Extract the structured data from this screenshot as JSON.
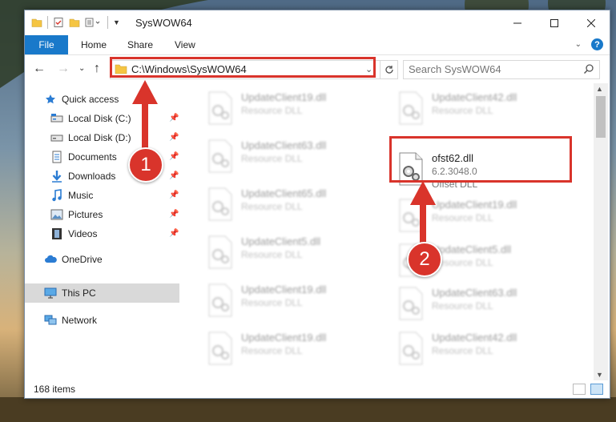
{
  "window": {
    "title": "SysWOW64"
  },
  "ribbon": {
    "tabs": [
      "File",
      "Home",
      "Share",
      "View"
    ],
    "help_label": "?"
  },
  "nav": {
    "back_label": "←",
    "forward_label": "→",
    "recent_label": "⌄",
    "up_label": "↑"
  },
  "address": {
    "path": "C:\\Windows\\SysWOW64"
  },
  "search": {
    "placeholder": "Search SysWOW64"
  },
  "sidebar": {
    "items": [
      {
        "label": "Quick access",
        "icon": "star-icon"
      },
      {
        "label": "Local Disk (C:)",
        "icon": "drive-icon"
      },
      {
        "label": "Local Disk (D:)",
        "icon": "drive-icon"
      },
      {
        "label": "Documents",
        "icon": "documents-icon"
      },
      {
        "label": "Downloads",
        "icon": "download-arrow-icon"
      },
      {
        "label": "Music",
        "icon": "music-note-icon"
      },
      {
        "label": "Pictures",
        "icon": "pictures-icon"
      },
      {
        "label": "Videos",
        "icon": "film-icon"
      },
      {
        "label": "OneDrive",
        "icon": "cloud-icon"
      },
      {
        "label": "This PC",
        "icon": "monitor-icon"
      },
      {
        "label": "Network",
        "icon": "network-icon"
      }
    ]
  },
  "files": {
    "col1": [
      {
        "name": "UpdateClient19.dll",
        "type": "Resource DLL"
      },
      {
        "name": "UpdateClient63.dll",
        "type": "Resource DLL"
      },
      {
        "name": "UpdateClient65.dll",
        "type": "Resource DLL"
      },
      {
        "name": "UpdateClient5.dll",
        "type": "Resource DLL"
      },
      {
        "name": "UpdateClient19.dll",
        "type": "Resource DLL"
      },
      {
        "name": "UpdateClient19.dll",
        "type": "Resource DLL"
      }
    ],
    "col2": [
      {
        "name": "UpdateClient42.dll",
        "type": "Resource DLL"
      },
      {
        "name": "ofst62.dll",
        "version": "6.2.3048.0",
        "type": "Offset DLL",
        "highlight": true
      },
      {
        "name": "UpdateClient19.dll",
        "type": "Resource DLL"
      },
      {
        "name": "UpdateClient5.dll",
        "type": "Resource DLL"
      },
      {
        "name": "UpdateClient63.dll",
        "type": "Resource DLL"
      },
      {
        "name": "UpdateClient42.dll",
        "type": "Resource DLL"
      }
    ]
  },
  "status": {
    "count": "168 items"
  },
  "callouts": {
    "one": "1",
    "two": "2"
  },
  "colors": {
    "accent": "#1979ca",
    "callout": "#d9342b",
    "selected_nav": "#d9d9d9"
  }
}
